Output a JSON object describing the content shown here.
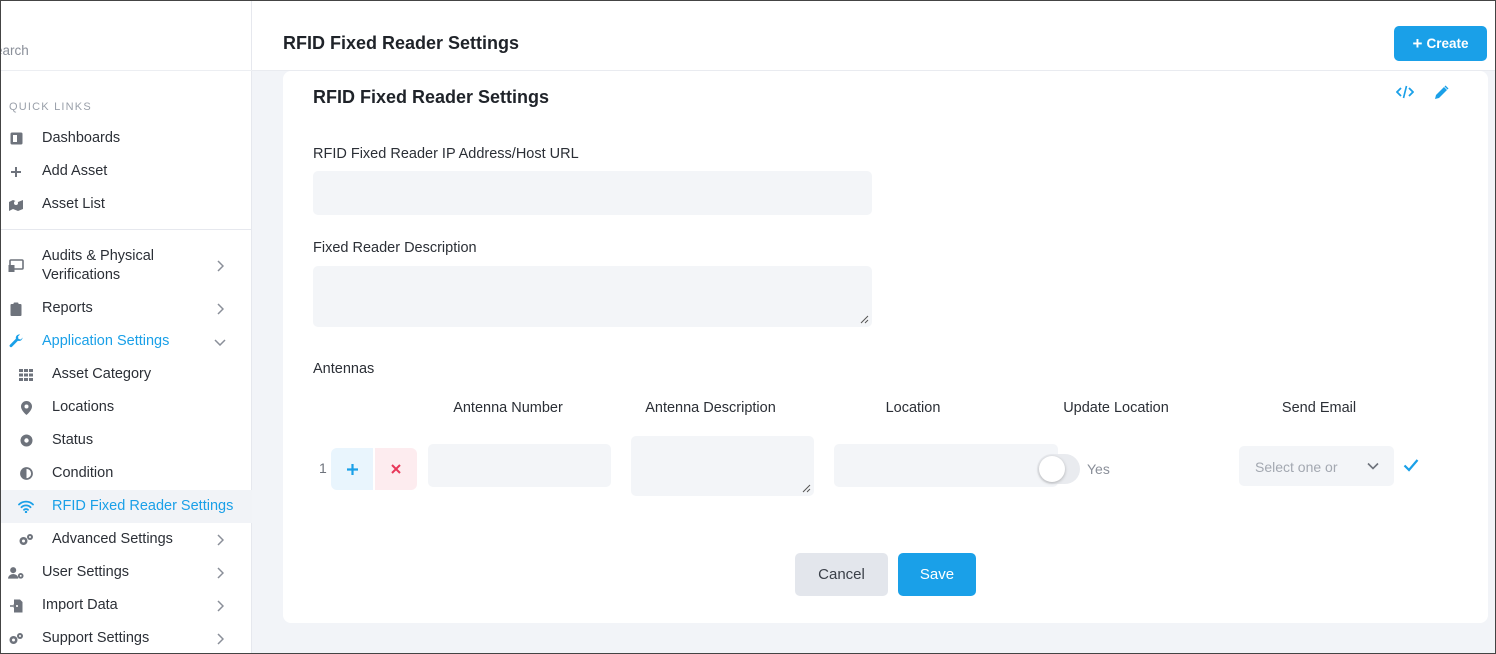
{
  "sidebar": {
    "search_placeholder": "earch",
    "quick_links_title": "QUICK LINKS",
    "items": [
      {
        "label": "Dashboards",
        "icon": "dashboard-icon"
      },
      {
        "label": "Add Asset",
        "icon": "plus-icon"
      },
      {
        "label": "Asset List",
        "icon": "map-icon"
      },
      {
        "label": "Audits & Physical Verifications",
        "icon": "audit-icon"
      },
      {
        "label": "Reports",
        "icon": "clipboard-icon"
      },
      {
        "label": "Application Settings",
        "icon": "wrench-icon"
      },
      {
        "label": "Asset Category",
        "icon": "grid-icon"
      },
      {
        "label": "Locations",
        "icon": "location-pin-icon"
      },
      {
        "label": "Status",
        "icon": "status-dot-icon"
      },
      {
        "label": "Condition",
        "icon": "half-circle-icon"
      },
      {
        "label": "RFID Fixed Reader Settings",
        "icon": "wifi-icon"
      },
      {
        "label": "Advanced Settings",
        "icon": "cogs-icon"
      },
      {
        "label": "User Settings",
        "icon": "user-cog-icon"
      },
      {
        "label": "Import Data",
        "icon": "import-icon"
      },
      {
        "label": "Support Settings",
        "icon": "cogs-icon"
      }
    ]
  },
  "header": {
    "title": "RFID Fixed Reader Settings",
    "create_label": "Create"
  },
  "card": {
    "title": "RFID Fixed Reader Settings",
    "ip_label": "RFID Fixed Reader IP Address/Host URL",
    "ip_value": "",
    "description_label": "Fixed Reader Description",
    "description_value": "",
    "antennas_label": "Antennas",
    "columns": [
      "Antenna Number",
      "Antenna Description",
      "Location",
      "Update Location",
      "Send Email"
    ],
    "rows": [
      {
        "index": "1",
        "antenna_number": "",
        "antenna_description": "",
        "location": "",
        "update_location_label": "Yes",
        "update_location_on": false,
        "send_email_placeholder": "Select one or"
      }
    ],
    "cancel_label": "Cancel",
    "save_label": "Save"
  },
  "colors": {
    "accent": "#1aa0e8",
    "danger": "#e8385a",
    "input_bg": "#f3f5f8"
  }
}
